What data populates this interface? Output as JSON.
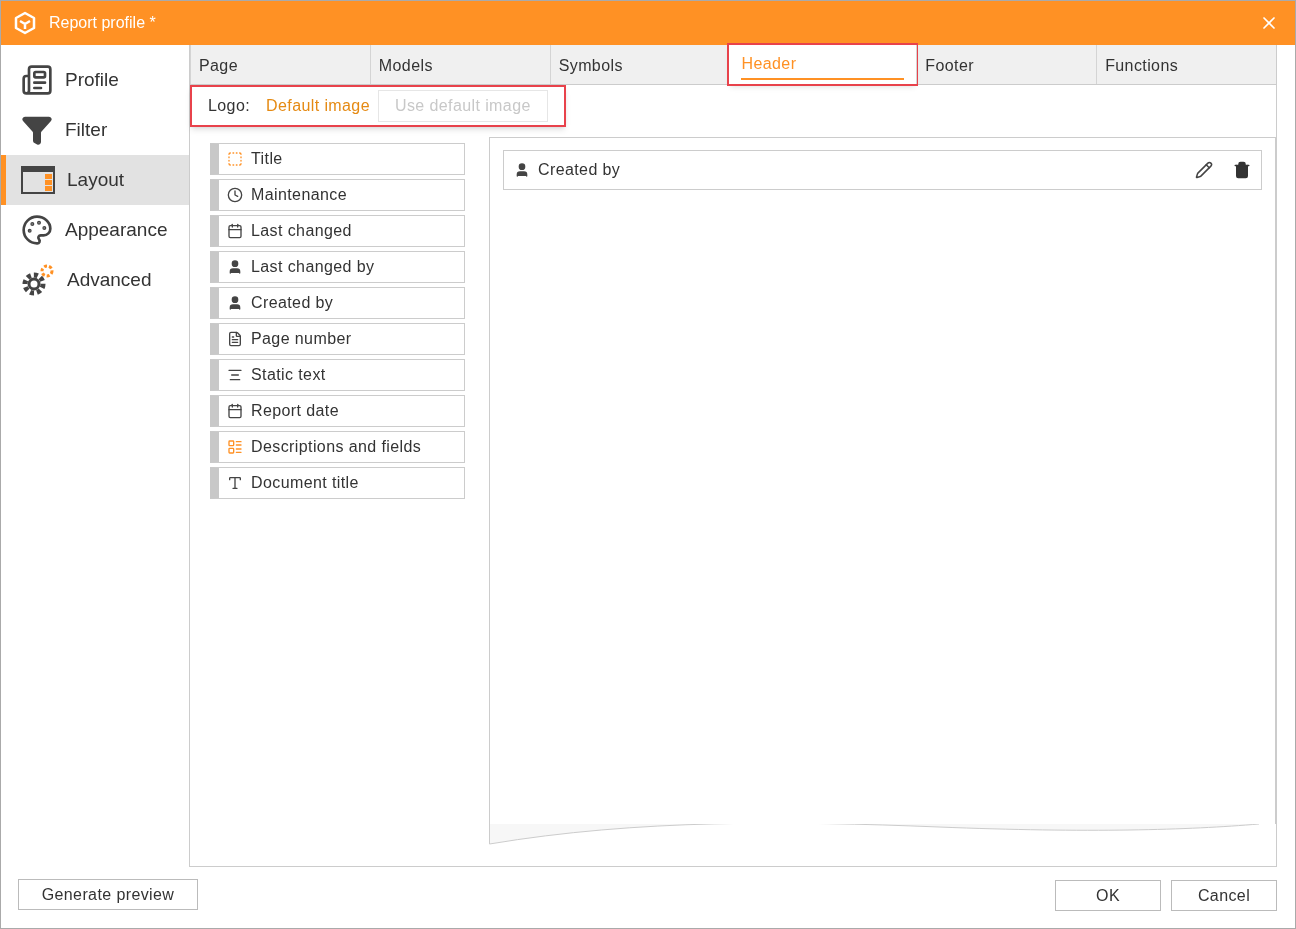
{
  "window": {
    "title": "Report profile *"
  },
  "sidebar": {
    "items": [
      {
        "label": "Profile",
        "kind": "profile",
        "selected": false
      },
      {
        "label": "Filter",
        "kind": "filter",
        "selected": false
      },
      {
        "label": "Layout",
        "kind": "layout",
        "selected": true
      },
      {
        "label": "Appearance",
        "kind": "appearance",
        "selected": false
      },
      {
        "label": "Advanced",
        "kind": "advanced",
        "selected": false
      }
    ]
  },
  "tabs": [
    {
      "label": "Page",
      "selected": false,
      "highlighted": false
    },
    {
      "label": "Models",
      "selected": false,
      "highlighted": false
    },
    {
      "label": "Symbols",
      "selected": false,
      "highlighted": false
    },
    {
      "label": "Header",
      "selected": true,
      "highlighted": true
    },
    {
      "label": "Footer",
      "selected": false,
      "highlighted": false
    },
    {
      "label": "Functions",
      "selected": false,
      "highlighted": false
    }
  ],
  "logo": {
    "label": "Logo:",
    "value": "Default image",
    "button": {
      "label": "Use default image",
      "disabled": true
    },
    "highlighted": true
  },
  "elements": [
    {
      "label": "Title",
      "kind": "title"
    },
    {
      "label": "Maintenance",
      "kind": "clock"
    },
    {
      "label": "Last changed",
      "kind": "calendar"
    },
    {
      "label": "Last changed by",
      "kind": "user"
    },
    {
      "label": "Created by",
      "kind": "user"
    },
    {
      "label": "Page number",
      "kind": "page"
    },
    {
      "label": "Static text",
      "kind": "text"
    },
    {
      "label": "Report date",
      "kind": "calendar"
    },
    {
      "label": "Descriptions and fields",
      "kind": "fields"
    },
    {
      "label": "Document title",
      "kind": "doctitle"
    }
  ],
  "header_items": [
    {
      "label": "Created by",
      "kind": "user"
    }
  ],
  "buttons": {
    "preview": "Generate preview",
    "ok": "OK",
    "cancel": "Cancel"
  }
}
